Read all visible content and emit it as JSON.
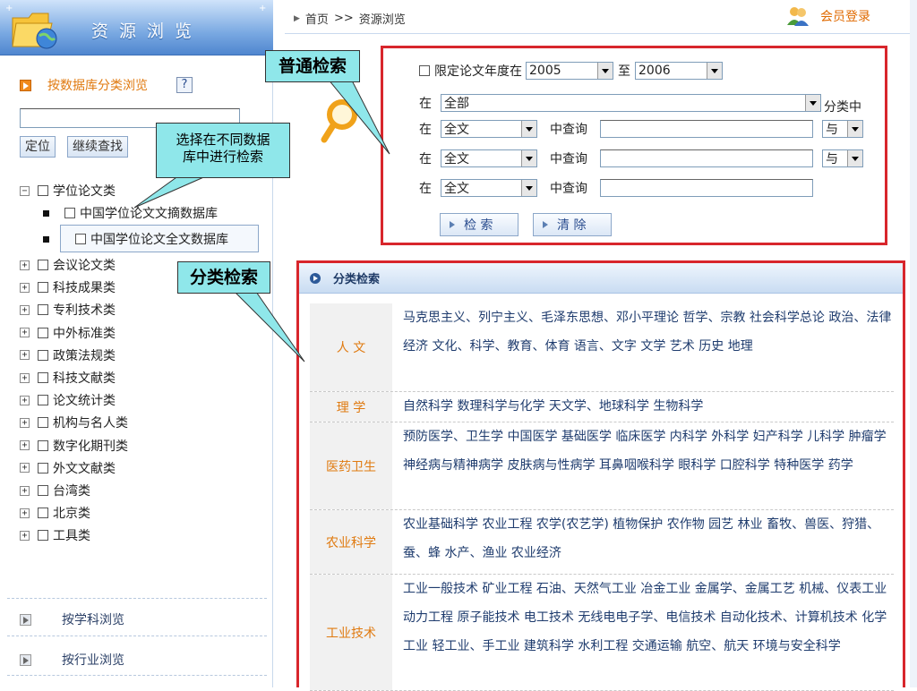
{
  "sidebar": {
    "title": "资源浏览",
    "db_browse_label": "按数据库分类浏览",
    "help_label": "?",
    "locate_button": "定位",
    "continue_button": "继续查找",
    "tree": {
      "root_label": "学位论文类",
      "children": [
        "中国学位论文文摘数据库",
        "中国学位论文全文数据库"
      ],
      "others": [
        "会议论文类",
        "科技成果类",
        "专利技术类",
        "中外标准类",
        "政策法规类",
        "科技文献类",
        "论文统计类",
        "机构与名人类",
        "数字化期刊类",
        "外文文献类",
        "台湾类",
        "北京类",
        "工具类"
      ]
    },
    "browse_subject": "按学科浏览",
    "browse_industry": "按行业浏览"
  },
  "topbar": {
    "breadcrumb_home": "首页",
    "breadcrumb_sep": ">>",
    "breadcrumb_current": "资源浏览",
    "member_login": "会员登录"
  },
  "search": {
    "limit_year_label": "限定论文年度在",
    "year_from": "2005",
    "year_to_label": "至",
    "year_to": "2006",
    "in_label": "在",
    "category_value": "全部",
    "category_suffix": "分类中",
    "field_value": "全文",
    "query_label": "中查询",
    "logic_value": "与",
    "search_button": "检 索",
    "clear_button": "清 除"
  },
  "categories": {
    "header": "分类检索",
    "rows": [
      {
        "label": "人  文",
        "items": "马克思主义、列宁主义、毛泽东思想、邓小平理论 哲学、宗教 社会科学总论 政治、法律 经济 文化、科学、教育、体育 语言、文字 文学 艺术 历史 地理"
      },
      {
        "label": "理  学",
        "items": "自然科学 数理科学与化学 天文学、地球科学 生物科学"
      },
      {
        "label": "医药卫生",
        "items": "预防医学、卫生学 中国医学 基础医学 临床医学 内科学 外科学 妇产科学 儿科学 肿瘤学 神经病与精神病学 皮肤病与性病学 耳鼻咽喉科学 眼科学 口腔科学 特种医学 药学"
      },
      {
        "label": "农业科学",
        "items": "农业基础科学 农业工程 农学(农艺学) 植物保护 农作物 园艺 林业 畜牧、兽医、狩猎、蚕、蜂 水产、渔业 农业经济"
      },
      {
        "label": "工业技术",
        "items": "工业一般技术 矿业工程 石油、天然气工业 冶金工业 金属学、金属工艺 机械、仪表工业 动力工程 原子能技术 电工技术 无线电电子学、电信技术 自动化技术、计算机技术 化学工业 轻工业、手工业 建筑科学 水利工程 交通运输 航空、航天 环境与安全科学"
      }
    ]
  },
  "callouts": {
    "general_search": "普通检索",
    "select_db_line1": "选择在不同数据",
    "select_db_line2": "库中进行检索",
    "category_search": "分类检索"
  },
  "colors": {
    "accent_orange": "#e07a10",
    "highlight_red": "#d8262c",
    "callout_cyan": "#8fe7ea",
    "link_blue": "#1f3c6e"
  }
}
